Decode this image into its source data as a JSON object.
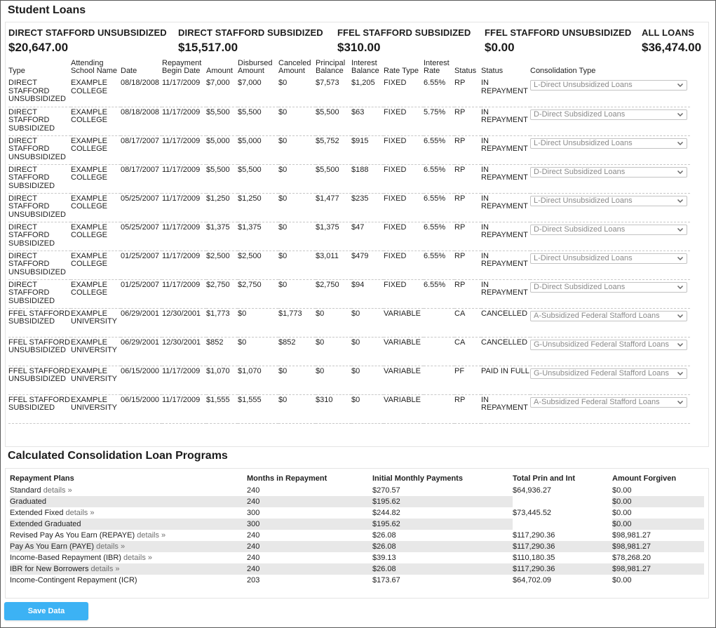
{
  "page": {
    "title": "Student Loans",
    "programs_title": "Calculated Consolidation Loan Programs",
    "save_label": "Save Data"
  },
  "colors": {
    "accent": "#3cb2f4",
    "alt_row": "#e8e8e8",
    "link": "#6f6f6f"
  },
  "summary": [
    {
      "label": "DIRECT STAFFORD UNSUBSIDIZED",
      "value": "$20,647.00"
    },
    {
      "label": "DIRECT STAFFORD SUBSIDIZED",
      "value": "$15,517.00"
    },
    {
      "label": "FFEL STAFFORD SUBSIDIZED",
      "value": "$310.00"
    },
    {
      "label": "FFEL STAFFORD UNSUBSIDIZED",
      "value": "$0.00"
    },
    {
      "label": "ALL LOANS",
      "value": "$36,474.00"
    }
  ],
  "loans_columns": [
    "Type",
    "Attending School Name",
    "Date",
    "Repayment Begin Date",
    "Amount",
    "Disbursed Amount",
    "Canceled Amount",
    "Principal Balance",
    "Interest Balance",
    "Rate Type",
    "Interest Rate",
    "Status",
    "Status",
    "Consolidation Type"
  ],
  "loans": [
    {
      "type": "DIRECT STAFFORD UNSUBSIDIZED",
      "school": "EXAMPLE COLLEGE",
      "date": "08/18/2008",
      "repay_begin": "11/17/2009",
      "amount": "$7,000",
      "disbursed": "$7,000",
      "canceled": "$0",
      "principal": "$7,573",
      "interest": "$1,205",
      "rate_type": "FIXED",
      "rate": "6.55%",
      "status_code": "RP",
      "status": "IN REPAYMENT",
      "consolidation": "L-Direct Unsubsidized Loans"
    },
    {
      "type": "DIRECT STAFFORD SUBSIDIZED",
      "school": "EXAMPLE COLLEGE",
      "date": "08/18/2008",
      "repay_begin": "11/17/2009",
      "amount": "$5,500",
      "disbursed": "$5,500",
      "canceled": "$0",
      "principal": "$5,500",
      "interest": "$63",
      "rate_type": "FIXED",
      "rate": "5.75%",
      "status_code": "RP",
      "status": "IN REPAYMENT",
      "consolidation": "D-Direct Subsidized Loans"
    },
    {
      "type": "DIRECT STAFFORD UNSUBSIDIZED",
      "school": "EXAMPLE COLLEGE",
      "date": "08/17/2007",
      "repay_begin": "11/17/2009",
      "amount": "$5,000",
      "disbursed": "$5,000",
      "canceled": "$0",
      "principal": "$5,752",
      "interest": "$915",
      "rate_type": "FIXED",
      "rate": "6.55%",
      "status_code": "RP",
      "status": "IN REPAYMENT",
      "consolidation": "L-Direct Unsubsidized Loans"
    },
    {
      "type": "DIRECT STAFFORD SUBSIDIZED",
      "school": "EXAMPLE COLLEGE",
      "date": "08/17/2007",
      "repay_begin": "11/17/2009",
      "amount": "$5,500",
      "disbursed": "$5,500",
      "canceled": "$0",
      "principal": "$5,500",
      "interest": "$188",
      "rate_type": "FIXED",
      "rate": "6.55%",
      "status_code": "RP",
      "status": "IN REPAYMENT",
      "consolidation": "D-Direct Subsidized Loans"
    },
    {
      "type": "DIRECT STAFFORD UNSUBSIDIZED",
      "school": "EXAMPLE COLLEGE",
      "date": "05/25/2007",
      "repay_begin": "11/17/2009",
      "amount": "$1,250",
      "disbursed": "$1,250",
      "canceled": "$0",
      "principal": "$1,477",
      "interest": "$235",
      "rate_type": "FIXED",
      "rate": "6.55%",
      "status_code": "RP",
      "status": "IN REPAYMENT",
      "consolidation": "L-Direct Unsubsidized Loans"
    },
    {
      "type": "DIRECT STAFFORD SUBSIDIZED",
      "school": "EXAMPLE COLLEGE",
      "date": "05/25/2007",
      "repay_begin": "11/17/2009",
      "amount": "$1,375",
      "disbursed": "$1,375",
      "canceled": "$0",
      "principal": "$1,375",
      "interest": "$47",
      "rate_type": "FIXED",
      "rate": "6.55%",
      "status_code": "RP",
      "status": "IN REPAYMENT",
      "consolidation": "D-Direct Subsidized Loans"
    },
    {
      "type": "DIRECT STAFFORD UNSUBSIDIZED",
      "school": "EXAMPLE COLLEGE",
      "date": "01/25/2007",
      "repay_begin": "11/17/2009",
      "amount": "$2,500",
      "disbursed": "$2,500",
      "canceled": "$0",
      "principal": "$3,011",
      "interest": "$479",
      "rate_type": "FIXED",
      "rate": "6.55%",
      "status_code": "RP",
      "status": "IN REPAYMENT",
      "consolidation": "L-Direct Unsubsidized Loans"
    },
    {
      "type": "DIRECT STAFFORD SUBSIDIZED",
      "school": "EXAMPLE COLLEGE",
      "date": "01/25/2007",
      "repay_begin": "11/17/2009",
      "amount": "$2,750",
      "disbursed": "$2,750",
      "canceled": "$0",
      "principal": "$2,750",
      "interest": "$94",
      "rate_type": "FIXED",
      "rate": "6.55%",
      "status_code": "RP",
      "status": "IN REPAYMENT",
      "consolidation": "D-Direct Subsidized Loans"
    },
    {
      "type": "FFEL STAFFORD SUBSIDIZED",
      "school": "EXAMPLE UNIVERSITY",
      "date": "06/29/2001",
      "repay_begin": "12/30/2001",
      "amount": "$1,773",
      "disbursed": "$0",
      "canceled": "$1,773",
      "principal": "$0",
      "interest": "$0",
      "rate_type": "VARIABLE",
      "rate": "",
      "status_code": "CA",
      "status": "CANCELLED",
      "consolidation": "A-Subsidized Federal Stafford Loans"
    },
    {
      "type": "FFEL STAFFORD UNSUBSIDIZED",
      "school": "EXAMPLE UNIVERSITY",
      "date": "06/29/2001",
      "repay_begin": "12/30/2001",
      "amount": "$852",
      "disbursed": "$0",
      "canceled": "$852",
      "principal": "$0",
      "interest": "$0",
      "rate_type": "VARIABLE",
      "rate": "",
      "status_code": "CA",
      "status": "CANCELLED",
      "consolidation": "G-Unsubsidized Federal Stafford Loans"
    },
    {
      "type": "FFEL STAFFORD UNSUBSIDIZED",
      "school": "EXAMPLE UNIVERSITY",
      "date": "06/15/2000",
      "repay_begin": "11/17/2009",
      "amount": "$1,070",
      "disbursed": "$1,070",
      "canceled": "$0",
      "principal": "$0",
      "interest": "$0",
      "rate_type": "VARIABLE",
      "rate": "",
      "status_code": "PF",
      "status": "PAID IN FULL",
      "consolidation": "G-Unsubsidized Federal Stafford Loans"
    },
    {
      "type": "FFEL STAFFORD SUBSIDIZED",
      "school": "EXAMPLE UNIVERSITY",
      "date": "06/15/2000",
      "repay_begin": "11/17/2009",
      "amount": "$1,555",
      "disbursed": "$1,555",
      "canceled": "$0",
      "principal": "$310",
      "interest": "$0",
      "rate_type": "VARIABLE",
      "rate": "",
      "status_code": "RP",
      "status": "IN REPAYMENT",
      "consolidation": "A-Subsidized Federal Stafford Loans"
    }
  ],
  "programs_columns": [
    "Repayment Plans",
    "Months in Repayment",
    "Initial Monthly Payments",
    "Total Prin and Int",
    "Amount Forgiven"
  ],
  "programs": [
    {
      "plan": "Standard",
      "details": "details »",
      "months": "240",
      "payment": "$270.57",
      "total": "$64,936.27",
      "forgiven": "$0.00"
    },
    {
      "plan": "Graduated",
      "details": "",
      "months": "240",
      "payment": "$195.62",
      "total": "",
      "forgiven": "$0.00"
    },
    {
      "plan": "Extended Fixed",
      "details": "details »",
      "months": "300",
      "payment": "$244.82",
      "total": "$73,445.52",
      "forgiven": "$0.00"
    },
    {
      "plan": "Extended Graduated",
      "details": "",
      "months": "300",
      "payment": "$195.62",
      "total": "",
      "forgiven": "$0.00"
    },
    {
      "plan": "Revised Pay As You Earn (REPAYE)",
      "details": "details »",
      "months": "240",
      "payment": "$26.08",
      "total": "$117,290.36",
      "forgiven": "$98,981.27"
    },
    {
      "plan": "Pay As You Earn (PAYE)",
      "details": "details »",
      "months": "240",
      "payment": "$26.08",
      "total": "$117,290.36",
      "forgiven": "$98,981.27"
    },
    {
      "plan": "Income-Based Repayment (IBR)",
      "details": "details »",
      "months": "240",
      "payment": "$39.13",
      "total": "$110,180.35",
      "forgiven": "$78,268.20"
    },
    {
      "plan": "IBR for New Borrowers",
      "details": "details »",
      "months": "240",
      "payment": "$26.08",
      "total": "$117,290.36",
      "forgiven": "$98,981.27"
    },
    {
      "plan": "Income-Contingent Repayment (ICR)",
      "details": "",
      "months": "203",
      "payment": "$173.67",
      "total": "$64,702.09",
      "forgiven": "$0.00"
    }
  ]
}
